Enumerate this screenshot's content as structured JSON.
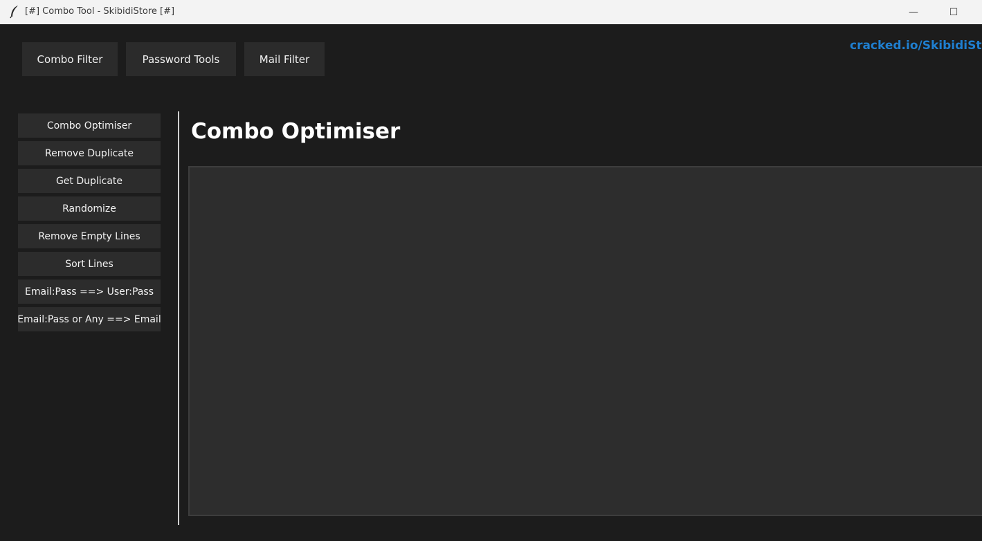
{
  "window": {
    "title": "[#] Combo Tool - SkibidiStore [#]",
    "app_icon": "feather-icon",
    "minimize_glyph": "—",
    "maximize_glyph": "☐"
  },
  "top_tabs": [
    {
      "label": "Combo Filter"
    },
    {
      "label": "Password Tools"
    },
    {
      "label": "Mail Filter"
    }
  ],
  "brand": {
    "text": "cracked.io/SkibidiSt",
    "color": "#1f7fd0"
  },
  "sidebar": {
    "items": [
      {
        "label": "Combo Optimiser"
      },
      {
        "label": "Remove Duplicate"
      },
      {
        "label": "Get Duplicate"
      },
      {
        "label": "Randomize"
      },
      {
        "label": "Remove Empty Lines"
      },
      {
        "label": "Sort Lines"
      },
      {
        "label": "Email:Pass ==> User:Pass"
      },
      {
        "label": "Email:Pass or Any ==> Email"
      }
    ]
  },
  "main": {
    "title": "Combo Optimiser",
    "editor_value": ""
  },
  "colors": {
    "background": "#1c1c1c",
    "button": "#2b2b2b",
    "editor": "#2d2d2d",
    "accent": "#1f7fd0"
  }
}
